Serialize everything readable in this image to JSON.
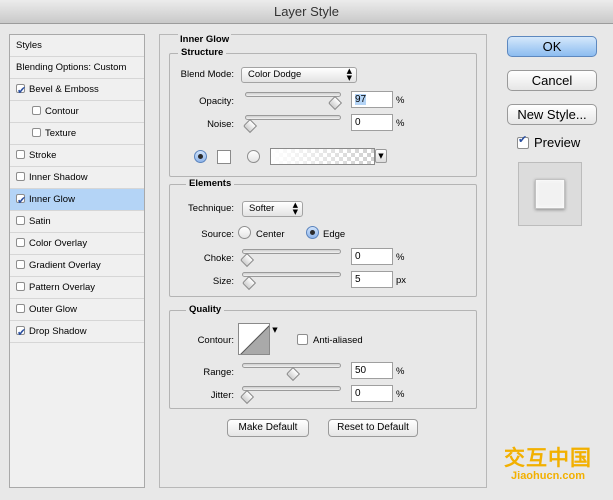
{
  "window": {
    "title": "Layer Style"
  },
  "style_list": [
    {
      "label": "Styles",
      "checkbox": false,
      "checked": false,
      "indent": false,
      "selected": false
    },
    {
      "label": "Blending Options: Custom",
      "checkbox": false,
      "checked": false,
      "indent": false,
      "selected": false
    },
    {
      "label": "Bevel & Emboss",
      "checkbox": true,
      "checked": true,
      "indent": false,
      "selected": false
    },
    {
      "label": "Contour",
      "checkbox": true,
      "checked": false,
      "indent": true,
      "selected": false
    },
    {
      "label": "Texture",
      "checkbox": true,
      "checked": false,
      "indent": true,
      "selected": false
    },
    {
      "label": "Stroke",
      "checkbox": true,
      "checked": false,
      "indent": false,
      "selected": false
    },
    {
      "label": "Inner Shadow",
      "checkbox": true,
      "checked": false,
      "indent": false,
      "selected": false
    },
    {
      "label": "Inner Glow",
      "checkbox": true,
      "checked": true,
      "indent": false,
      "selected": true
    },
    {
      "label": "Satin",
      "checkbox": true,
      "checked": false,
      "indent": false,
      "selected": false
    },
    {
      "label": "Color Overlay",
      "checkbox": true,
      "checked": false,
      "indent": false,
      "selected": false
    },
    {
      "label": "Gradient Overlay",
      "checkbox": true,
      "checked": false,
      "indent": false,
      "selected": false
    },
    {
      "label": "Pattern Overlay",
      "checkbox": true,
      "checked": false,
      "indent": false,
      "selected": false
    },
    {
      "label": "Outer Glow",
      "checkbox": true,
      "checked": false,
      "indent": false,
      "selected": false
    },
    {
      "label": "Drop Shadow",
      "checkbox": true,
      "checked": true,
      "indent": false,
      "selected": false
    }
  ],
  "panel": {
    "title": "Inner Glow",
    "structure": {
      "title": "Structure",
      "blend_mode_label": "Blend Mode:",
      "blend_mode_value": "Color Dodge",
      "opacity_label": "Opacity:",
      "opacity_value": "97",
      "opacity_unit": "%",
      "opacity_level": 0.97,
      "noise_label": "Noise:",
      "noise_value": "0",
      "noise_unit": "%",
      "noise_level": 0,
      "color_mode": "solid"
    },
    "elements": {
      "title": "Elements",
      "technique_label": "Technique:",
      "technique_value": "Softer",
      "source_label": "Source:",
      "source_center_label": "Center",
      "source_edge_label": "Edge",
      "source_selected": "edge",
      "choke_label": "Choke:",
      "choke_value": "0",
      "choke_unit": "%",
      "choke_level": 0,
      "size_label": "Size:",
      "size_value": "5",
      "size_unit": "px",
      "size_level": 0.02
    },
    "quality": {
      "title": "Quality",
      "contour_label": "Contour:",
      "anti_aliased_label": "Anti-aliased",
      "anti_aliased_checked": false,
      "range_label": "Range:",
      "range_value": "50",
      "range_unit": "%",
      "range_level": 0.5,
      "jitter_label": "Jitter:",
      "jitter_value": "0",
      "jitter_unit": "%",
      "jitter_level": 0
    },
    "make_default_label": "Make Default",
    "reset_default_label": "Reset to Default"
  },
  "buttons": {
    "ok": "OK",
    "cancel": "Cancel",
    "new_style": "New Style...",
    "preview_label": "Preview",
    "preview_checked": true
  },
  "watermark": {
    "logo": "交互中国",
    "url": "Jiaohucn.com"
  },
  "colors": {
    "selection": "#b4d4f6",
    "accent": "#2a4f9f",
    "watermark": "#f2b000"
  }
}
